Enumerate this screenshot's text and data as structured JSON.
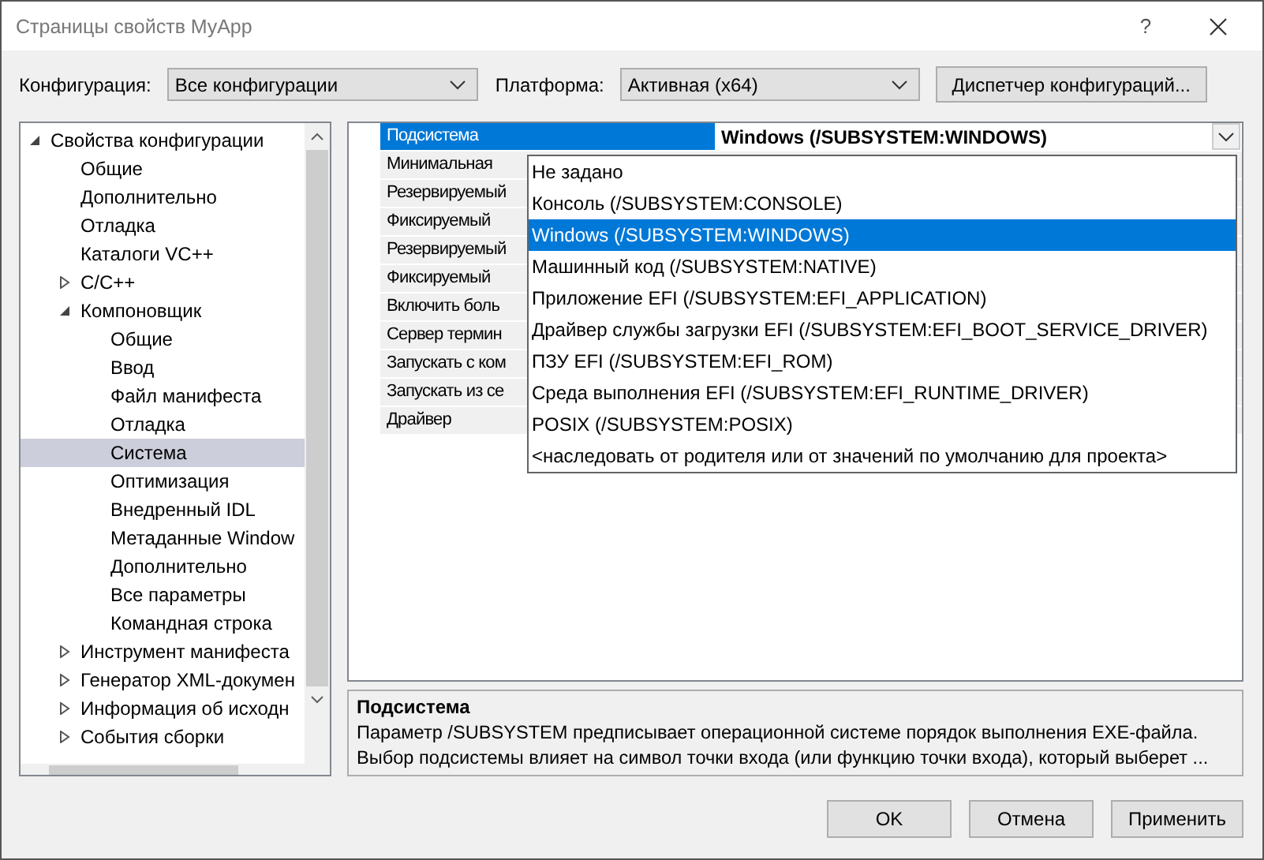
{
  "window": {
    "title": "Страницы свойств MyApp",
    "help": "?"
  },
  "toolbar": {
    "configuration_label": "Конфигурация:",
    "configuration": "Все конфигурации",
    "platform_label": "Платформа:",
    "platform": "Активная (x64)",
    "manager_button": "Диспетчер конфигураций..."
  },
  "tree": {
    "items": [
      {
        "label": "Свойства конфигурации",
        "expanded": true,
        "selected": false,
        "children": [
          {
            "label": "Общие",
            "selected": false
          },
          {
            "label": "Дополнительно",
            "selected": false
          },
          {
            "label": "Отладка",
            "selected": false
          },
          {
            "label": "Каталоги VC++",
            "selected": false
          },
          {
            "label": "C/C++",
            "expanded": false,
            "selected": false
          },
          {
            "label": "Компоновщик",
            "expanded": true,
            "selected": false,
            "children": [
              {
                "label": "Общие",
                "selected": false
              },
              {
                "label": "Ввод",
                "selected": false
              },
              {
                "label": "Файл манифеста",
                "selected": false
              },
              {
                "label": "Отладка",
                "selected": false
              },
              {
                "label": "Система",
                "selected": true
              },
              {
                "label": "Оптимизация",
                "selected": false
              },
              {
                "label": "Внедренный IDL",
                "selected": false
              },
              {
                "label": "Метаданные Window",
                "selected": false
              },
              {
                "label": "Дополнительно",
                "selected": false
              },
              {
                "label": "Все параметры",
                "selected": false
              },
              {
                "label": "Командная строка",
                "selected": false
              }
            ]
          },
          {
            "label": "Инструмент манифеста",
            "expanded": false,
            "selected": false
          },
          {
            "label": "Генератор XML-докумен",
            "expanded": false,
            "selected": false
          },
          {
            "label": "Информация об исходн",
            "expanded": false,
            "selected": false
          },
          {
            "label": "События сборки",
            "expanded": false,
            "selected": false
          }
        ]
      }
    ]
  },
  "grid": {
    "properties": [
      {
        "name": "Подсистема",
        "value": "Windows (/SUBSYSTEM:WINDOWS)",
        "selected": true
      },
      {
        "name": "Минимальная",
        "selected": false
      },
      {
        "name": "Резервируемый",
        "selected": false
      },
      {
        "name": "Фиксируемый",
        "selected": false
      },
      {
        "name": "Резервируемый",
        "selected": false
      },
      {
        "name": "Фиксируемый",
        "selected": false
      },
      {
        "name": "Включить боль",
        "selected": false
      },
      {
        "name": "Сервер термин",
        "selected": false
      },
      {
        "name": "Запускать с ком",
        "selected": false
      },
      {
        "name": "Запускать из се",
        "selected": false
      },
      {
        "name": "Драйвер",
        "selected": false
      }
    ]
  },
  "dropdown": {
    "options": [
      {
        "label": "Не задано",
        "selected": false
      },
      {
        "label": "Консоль (/SUBSYSTEM:CONSOLE)",
        "selected": false
      },
      {
        "label": "Windows (/SUBSYSTEM:WINDOWS)",
        "selected": true
      },
      {
        "label": "Машинный код (/SUBSYSTEM:NATIVE)",
        "selected": false
      },
      {
        "label": "Приложение EFI (/SUBSYSTEM:EFI_APPLICATION)",
        "selected": false
      },
      {
        "label": "Драйвер службы загрузки EFI (/SUBSYSTEM:EFI_BOOT_SERVICE_DRIVER)",
        "selected": false
      },
      {
        "label": "ПЗУ EFI (/SUBSYSTEM:EFI_ROM)",
        "selected": false
      },
      {
        "label": "Среда выполнения EFI (/SUBSYSTEM:EFI_RUNTIME_DRIVER)",
        "selected": false
      },
      {
        "label": "POSIX (/SUBSYSTEM:POSIX)",
        "selected": false
      },
      {
        "label": "<наследовать от родителя или от значений по умолчанию для проекта>",
        "selected": false
      }
    ]
  },
  "description": {
    "title": "Подсистема",
    "lines": [
      "Параметр /SUBSYSTEM предписывает операционной системе порядок выполнения EXE-файла.",
      "Выбор подсистемы влияет на символ точки входа (или функцию точки входа), который выберет ..."
    ]
  },
  "buttons": [
    "OK",
    "Отмена",
    "Применить"
  ]
}
